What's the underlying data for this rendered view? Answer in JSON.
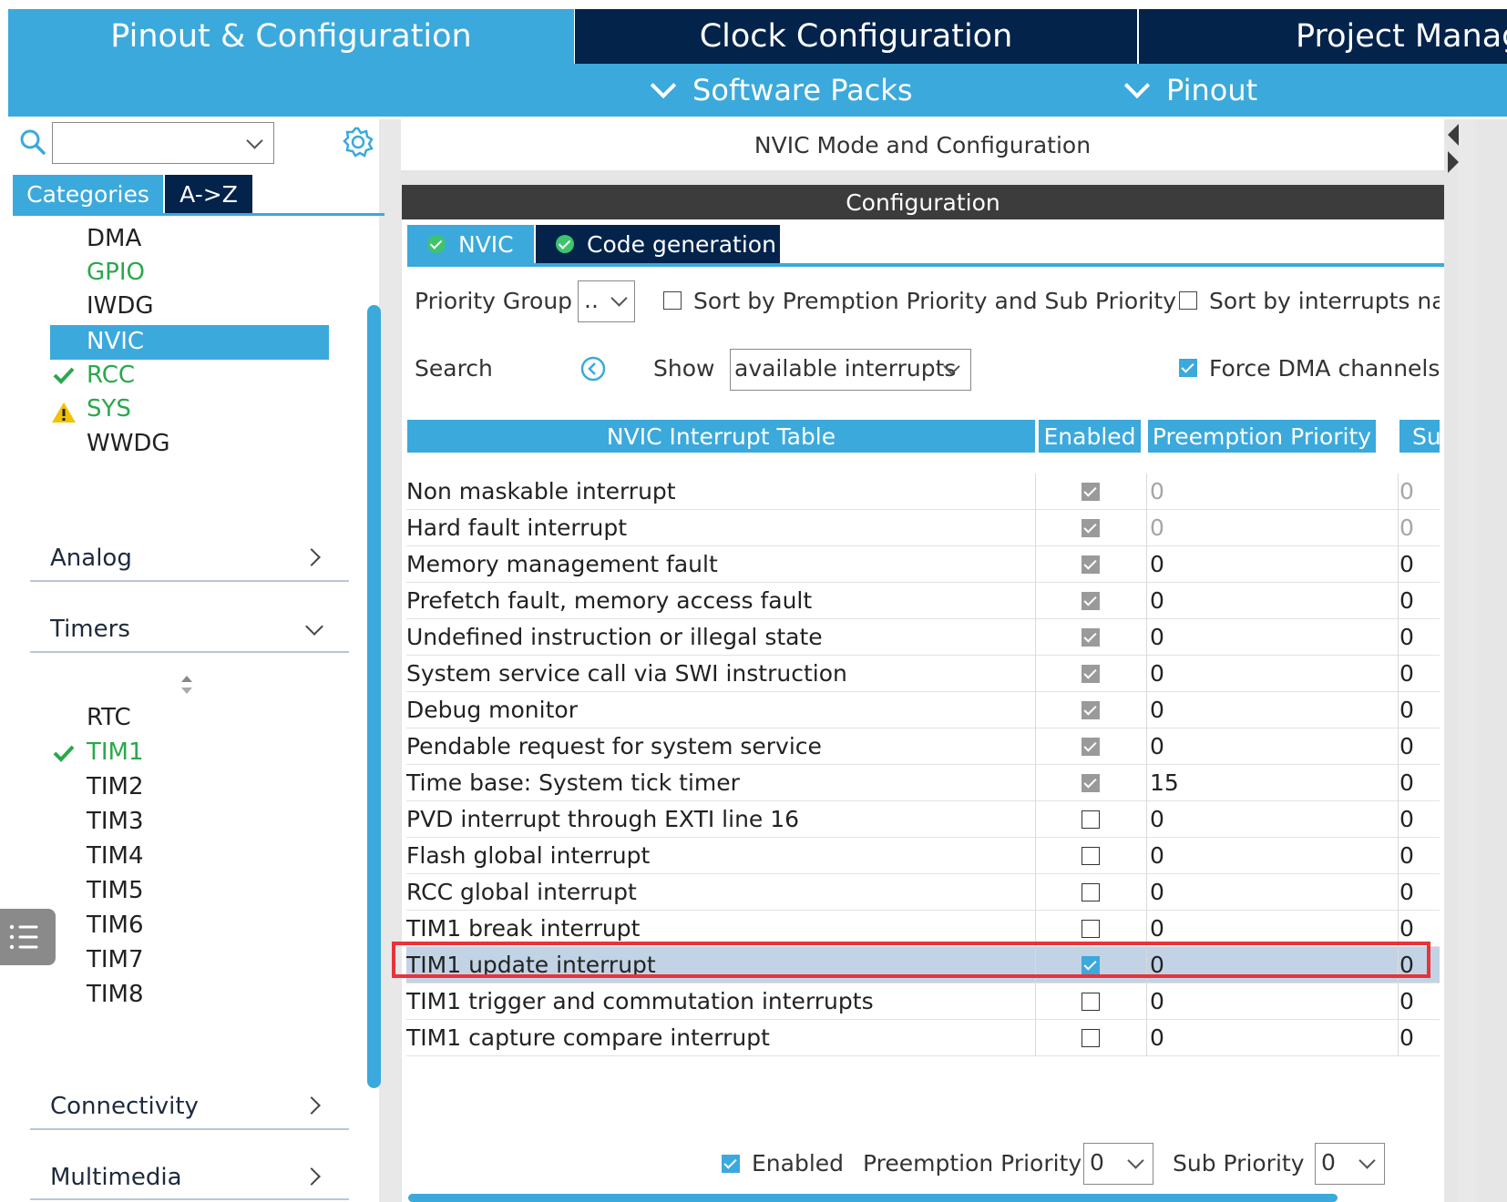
{
  "top_tabs": {
    "pinout": "Pinout & Configuration",
    "clock": "Clock Configuration",
    "project": "Project Manag"
  },
  "submenus": {
    "software_packs": "Software Packs",
    "pinout": "Pinout"
  },
  "sidebar": {
    "search_value": "",
    "tab_categories": "Categories",
    "tab_az": "A->Z",
    "system_core_items": [
      {
        "label": "DMA",
        "status": "none"
      },
      {
        "label": "GPIO",
        "status": "green"
      },
      {
        "label": "IWDG",
        "status": "none"
      },
      {
        "label": "NVIC",
        "status": "selected"
      },
      {
        "label": "RCC",
        "status": "check"
      },
      {
        "label": "SYS",
        "status": "warning"
      },
      {
        "label": "WWDG",
        "status": "none"
      }
    ],
    "categories": {
      "analog": "Analog",
      "timers": "Timers",
      "connectivity": "Connectivity",
      "multimedia": "Multimedia"
    },
    "timer_items": [
      {
        "label": "RTC",
        "status": "none"
      },
      {
        "label": "TIM1",
        "status": "check"
      },
      {
        "label": "TIM2",
        "status": "none"
      },
      {
        "label": "TIM3",
        "status": "none"
      },
      {
        "label": "TIM4",
        "status": "none"
      },
      {
        "label": "TIM5",
        "status": "none"
      },
      {
        "label": "TIM6",
        "status": "none"
      },
      {
        "label": "TIM7",
        "status": "none"
      },
      {
        "label": "TIM8",
        "status": "none"
      }
    ]
  },
  "main": {
    "mode_title": "NVIC Mode and Configuration",
    "config_title": "Configuration",
    "tabs": [
      {
        "label": "NVIC"
      },
      {
        "label": "Code generation"
      }
    ],
    "priority_group_label": "Priority Group",
    "priority_group_value": "..",
    "sort_premption_label": "Sort by Premption Priority and Sub Priority",
    "sort_names_label": "Sort by interrupts nam",
    "search_label": "Search",
    "show_label": "Show",
    "show_value": "available interrupts",
    "force_dma_label": "Force DMA channels",
    "table": {
      "headers": [
        "NVIC Interrupt Table",
        "Enabled",
        "Preemption Priority",
        "Su"
      ],
      "rows": [
        {
          "name": "Non maskable interrupt",
          "enabled": "disabled-checked",
          "preemption": "0",
          "sub": "0",
          "muted": true
        },
        {
          "name": "Hard fault interrupt",
          "enabled": "disabled-checked",
          "preemption": "0",
          "sub": "0",
          "muted": true
        },
        {
          "name": "Memory management fault",
          "enabled": "disabled-checked",
          "preemption": "0",
          "sub": "0",
          "muted": false
        },
        {
          "name": "Prefetch fault, memory access fault",
          "enabled": "disabled-checked",
          "preemption": "0",
          "sub": "0",
          "muted": false
        },
        {
          "name": "Undefined instruction or illegal state",
          "enabled": "disabled-checked",
          "preemption": "0",
          "sub": "0",
          "muted": false
        },
        {
          "name": "System service call via SWI instruction",
          "enabled": "disabled-checked",
          "preemption": "0",
          "sub": "0",
          "muted": false
        },
        {
          "name": "Debug monitor",
          "enabled": "disabled-checked",
          "preemption": "0",
          "sub": "0",
          "muted": false
        },
        {
          "name": "Pendable request for system service",
          "enabled": "disabled-checked",
          "preemption": "0",
          "sub": "0",
          "muted": false
        },
        {
          "name": "Time base: System tick timer",
          "enabled": "disabled-checked",
          "preemption": "15",
          "sub": "0",
          "muted": false
        },
        {
          "name": "PVD interrupt through EXTI line 16",
          "enabled": "unchecked",
          "preemption": "0",
          "sub": "0",
          "muted": false
        },
        {
          "name": "Flash global interrupt",
          "enabled": "unchecked",
          "preemption": "0",
          "sub": "0",
          "muted": false
        },
        {
          "name": "RCC global interrupt",
          "enabled": "unchecked",
          "preemption": "0",
          "sub": "0",
          "muted": false
        },
        {
          "name": "TIM1 break interrupt",
          "enabled": "unchecked",
          "preemption": "0",
          "sub": "0",
          "muted": false
        },
        {
          "name": "TIM1 update interrupt",
          "enabled": "checked",
          "preemption": "0",
          "sub": "0",
          "muted": false,
          "selected": true
        },
        {
          "name": "TIM1 trigger and commutation interrupts",
          "enabled": "unchecked",
          "preemption": "0",
          "sub": "0",
          "muted": false
        },
        {
          "name": "TIM1 capture compare interrupt",
          "enabled": "unchecked",
          "preemption": "0",
          "sub": "0",
          "muted": false
        }
      ]
    },
    "bottom": {
      "enabled_label": "Enabled",
      "preemption_label": "Preemption Priority",
      "preemption_value": "0",
      "sub_label": "Sub Priority",
      "sub_value": "0"
    }
  },
  "colors": {
    "accent": "#3ba9dc",
    "dark_navy": "#03234b",
    "status_green": "#29a84b",
    "warning": "#f2c200",
    "highlight_red": "#e8333a"
  }
}
